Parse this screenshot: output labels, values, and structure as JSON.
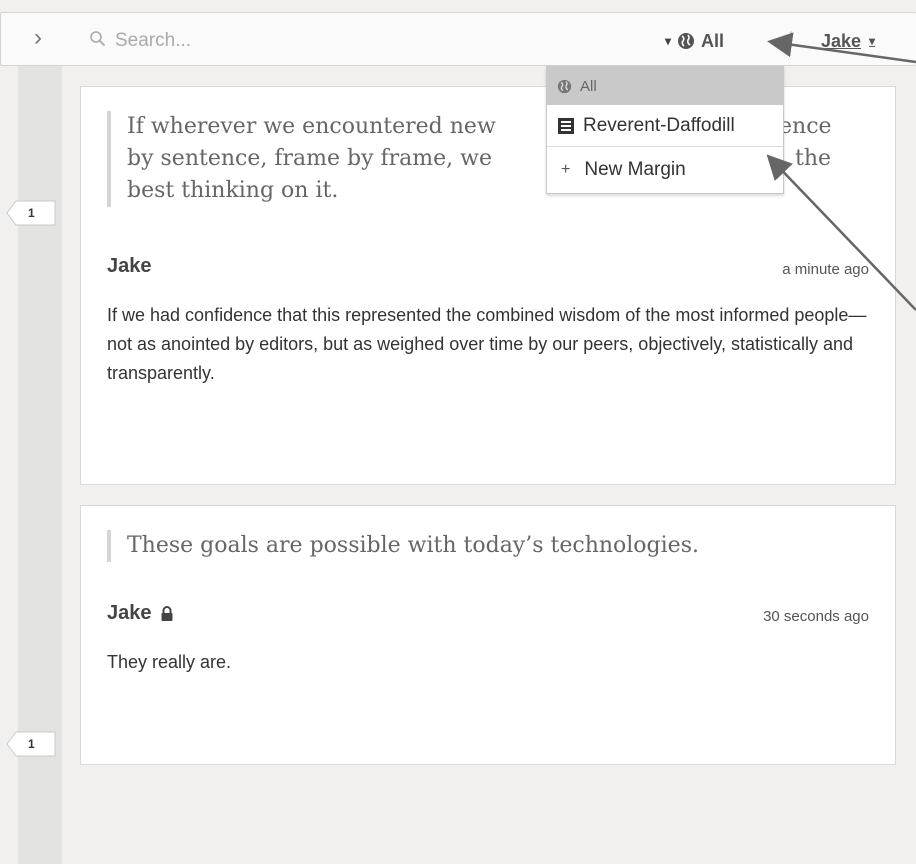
{
  "toolbar": {
    "collapse_glyph": "›",
    "search_placeholder": "Search...",
    "scope_label": "All",
    "user_label": "Jake",
    "caret": "▾",
    "divider": "/"
  },
  "dropdown": {
    "items": [
      {
        "label": "All",
        "icon": "globe-icon"
      },
      {
        "label": "Reverent-Daffodill",
        "icon": "group-icon"
      },
      {
        "label": "New Margin",
        "icon": "plus-icon"
      }
    ]
  },
  "annotations": [
    {
      "quote": "If wherever we encountered new ideas—sentence by sentence, frame by frame, we could find the best thinking on it.",
      "quote_lines": [
        "If wherever we encountered new",
        "by sentence, frame by frame, we",
        "best thinking on it."
      ],
      "quote_right": [
        "ence",
        "the"
      ],
      "author": "Jake",
      "timestamp": "a minute ago",
      "body": "If we had confidence that this represented the combined wisdom of the most informed people—not as anointed by editors, but as weighed over time by our peers, objectively, statistically and transparently.",
      "count": "1"
    },
    {
      "quote": "These goals are possible with today’s technologies.",
      "author": "Jake",
      "private": true,
      "timestamp": "30 seconds ago",
      "body": "They really are.",
      "count": "1"
    }
  ],
  "colors": {
    "background": "#f1f0ee",
    "card": "#ffffff",
    "dropdown_highlight": "#c9c9c9",
    "arrow": "#666666"
  }
}
